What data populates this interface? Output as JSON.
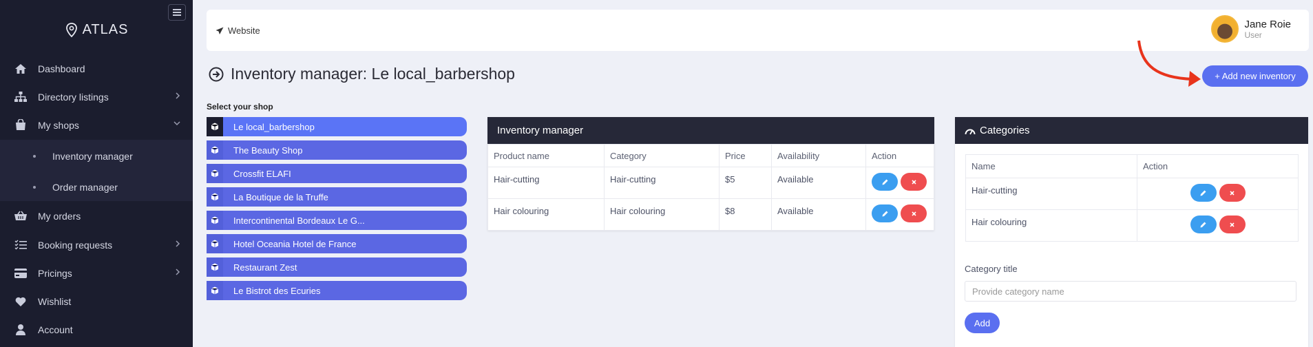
{
  "app": {
    "brand": "ATLAS"
  },
  "sidebar": {
    "items": [
      {
        "label": "Dashboard",
        "icon": "home-icon"
      },
      {
        "label": "Directory listings",
        "icon": "sitemap-icon",
        "chevron": "right"
      },
      {
        "label": "My shops",
        "icon": "bag-icon",
        "chevron": "down"
      },
      {
        "label": "Inventory manager",
        "sub": true
      },
      {
        "label": "Order manager",
        "sub": true
      },
      {
        "label": "My orders",
        "icon": "basket-icon"
      },
      {
        "label": "Booking requests",
        "icon": "checklist-icon",
        "chevron": "right"
      },
      {
        "label": "Pricings",
        "icon": "credit-card-icon",
        "chevron": "right"
      },
      {
        "label": "Wishlist",
        "icon": "heart-icon"
      },
      {
        "label": "Account",
        "icon": "user-icon"
      }
    ]
  },
  "topbar": {
    "website_label": "Website",
    "user_name": "Jane Roie",
    "user_role": "User"
  },
  "page": {
    "title": "Inventory manager: Le local_barbershop",
    "add_button": "+ Add new inventory",
    "select_shop_label": "Select your shop"
  },
  "shops": [
    {
      "name": "Le local_barbershop",
      "active": true
    },
    {
      "name": "The Beauty Shop"
    },
    {
      "name": "Crossfit ELAFI"
    },
    {
      "name": "La Boutique de la Truffe"
    },
    {
      "name": "Intercontinental Bordeaux Le G..."
    },
    {
      "name": "Hotel Oceania Hotel de France"
    },
    {
      "name": "Restaurant Zest"
    },
    {
      "name": "Le Bistrot des Ecuries"
    }
  ],
  "inventory": {
    "title": "Inventory manager",
    "columns": [
      "Product name",
      "Category",
      "Price",
      "Availability",
      "Action"
    ],
    "rows": [
      [
        "Hair-cutting",
        "Hair-cutting",
        "$5",
        "Available"
      ],
      [
        "Hair colouring",
        "Hair colouring",
        "$8",
        "Available"
      ]
    ]
  },
  "categories": {
    "title": "Categories",
    "columns": [
      "Name",
      "Action"
    ],
    "rows": [
      [
        "Hair-cutting"
      ],
      [
        "Hair colouring"
      ]
    ],
    "form_label": "Category title",
    "input_placeholder": "Provide category name",
    "add_button": "Add"
  },
  "colors": {
    "accent": "#5a6ff0",
    "sidebar_bg": "#1b1d2e",
    "edit": "#3b9ef0",
    "delete": "#ef4d4f",
    "annotation_arrow": "#e8341c"
  }
}
